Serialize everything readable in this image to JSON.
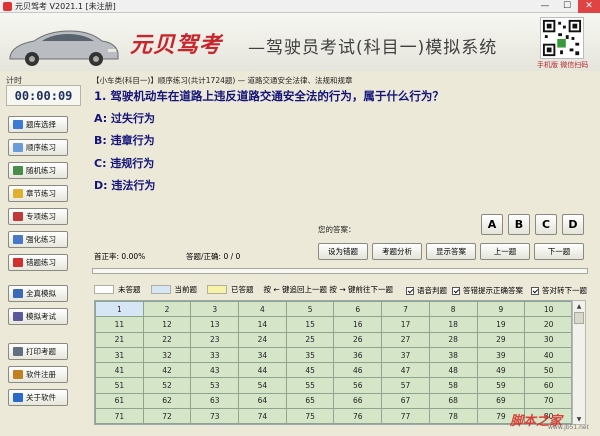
{
  "window": {
    "title": "元贝驾考 V2021.1 [未注册]",
    "controls": [
      "—",
      "☐",
      "✕"
    ]
  },
  "banner": {
    "logo": "元贝驾考",
    "slogan": "—驾驶员考试(科目一)模拟系统",
    "qr_caption": "手机版 微信扫码"
  },
  "timer": {
    "label": "计时",
    "value": "00:00:09"
  },
  "sidebar": {
    "items": [
      {
        "label": "题库选择",
        "icon": "grid-icon",
        "color": "#3b7bd4"
      },
      {
        "label": "顺序练习",
        "icon": "list-icon",
        "color": "#6b9bd8"
      },
      {
        "label": "随机练习",
        "icon": "shuffle-icon",
        "color": "#4a8c4a"
      },
      {
        "label": "章节练习",
        "icon": "folder-icon",
        "color": "#e0b030"
      },
      {
        "label": "专项练习",
        "icon": "target-icon",
        "color": "#c03838"
      },
      {
        "label": "强化练习",
        "icon": "chart-icon",
        "color": "#4a78c8"
      },
      {
        "label": "错题练习",
        "icon": "flag-icon",
        "color": "#d03030"
      },
      {
        "label": "全真模拟",
        "icon": "monitor-icon",
        "color": "#3a6ab8"
      },
      {
        "label": "模拟考试",
        "icon": "pencil-icon",
        "color": "#5a5a9a"
      },
      {
        "label": "打印考题",
        "icon": "printer-icon",
        "color": "#607080"
      },
      {
        "label": "软件注册",
        "icon": "key-icon",
        "color": "#c08020"
      },
      {
        "label": "关于软件",
        "icon": "info-icon",
        "color": "#2a6ac8"
      }
    ]
  },
  "question": {
    "header": "【小车类(科目一)】顺序练习(共计1724题) — 道路交通安全法律、法规和规章",
    "text": "1. 驾驶机动车在道路上违反道路交通安全法的行为，属于什么行为？",
    "options": [
      "A: 过失行为",
      "B: 违章行为",
      "C: 违规行为",
      "D: 违法行为"
    ]
  },
  "answer": {
    "label": "您的答案：",
    "choices": [
      "A",
      "B",
      "C",
      "D"
    ]
  },
  "stats": {
    "accuracy": "首正率: 0.00%",
    "count": "答题/正确: 0 / 0"
  },
  "actions": [
    "设为错题",
    "考题分析",
    "显示答案",
    "上一题",
    "下一题"
  ],
  "legend": {
    "items": [
      {
        "label": "未答题",
        "color": "#ffffff"
      },
      {
        "label": "当前题",
        "color": "#d7e6f4"
      },
      {
        "label": "已答题",
        "color": "#f8f2a8"
      }
    ],
    "hint": "按 ← 键追回上一题    按 → 键前往下一题"
  },
  "options_checks": [
    "语音判题",
    "答错提示正确答案",
    "答对转下一题"
  ],
  "grid": {
    "rows": [
      [
        "1",
        "2",
        "3",
        "4",
        "5",
        "6",
        "7",
        "8",
        "9",
        "10"
      ],
      [
        "11",
        "12",
        "13",
        "14",
        "15",
        "16",
        "17",
        "18",
        "19",
        "20"
      ],
      [
        "21",
        "22",
        "23",
        "24",
        "25",
        "26",
        "27",
        "28",
        "29",
        "30"
      ],
      [
        "31",
        "32",
        "33",
        "34",
        "35",
        "36",
        "37",
        "38",
        "39",
        "40"
      ],
      [
        "41",
        "42",
        "43",
        "44",
        "45",
        "46",
        "47",
        "48",
        "49",
        "50"
      ],
      [
        "51",
        "52",
        "53",
        "54",
        "55",
        "56",
        "57",
        "58",
        "59",
        "60"
      ],
      [
        "61",
        "62",
        "63",
        "64",
        "65",
        "66",
        "67",
        "68",
        "69",
        "70"
      ],
      [
        "71",
        "72",
        "73",
        "74",
        "75",
        "76",
        "77",
        "78",
        "79",
        "80"
      ]
    ]
  },
  "watermark": {
    "text": "脚本之家",
    "sub": "www.jb51.net"
  }
}
